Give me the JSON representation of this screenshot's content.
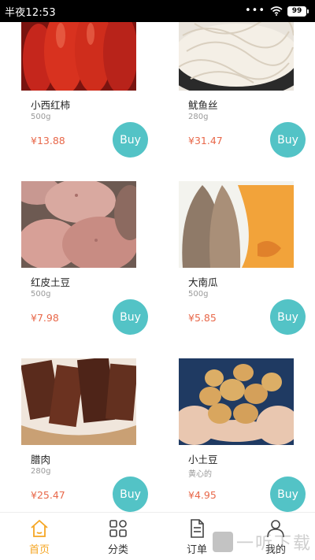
{
  "status_bar": {
    "time": "半夜12:53",
    "battery": "99"
  },
  "products": [
    {
      "name": "小西红柿",
      "weight": "500g",
      "price": "¥13.88",
      "buy_label": "Buy"
    },
    {
      "name": "鱿鱼丝",
      "weight": "280g",
      "price": "¥31.47",
      "buy_label": "Buy"
    },
    {
      "name": "红皮土豆",
      "weight": "500g",
      "price": "¥7.98",
      "buy_label": "Buy"
    },
    {
      "name": "大南瓜",
      "weight": "500g",
      "price": "¥5.85",
      "buy_label": "Buy"
    },
    {
      "name": "腊肉",
      "weight": "280g",
      "price": "¥25.47",
      "buy_label": "Buy"
    },
    {
      "name": "小土豆",
      "weight": "黄心的",
      "price": "¥4.95",
      "buy_label": "Buy"
    }
  ],
  "tabbar": {
    "home": "首页",
    "category": "分类",
    "orders": "订单",
    "mine": "我的"
  },
  "colors": {
    "accent": "#53c3c6",
    "price": "#e8684a",
    "active_tab": "#f5a623"
  },
  "watermark": {
    "text": "一听下载"
  }
}
